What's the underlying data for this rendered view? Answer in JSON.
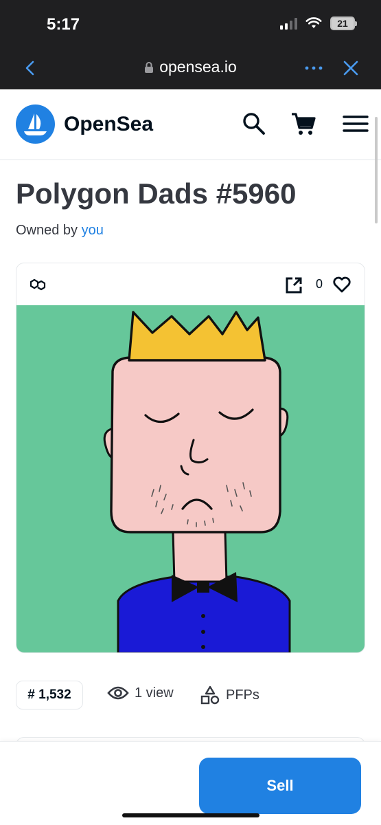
{
  "status_bar": {
    "time": "5:17",
    "battery": "21"
  },
  "browser": {
    "url": "opensea.io"
  },
  "header": {
    "logo_text": "OpenSea"
  },
  "nft": {
    "title": "Polygon Dads #5960",
    "owned_by_label": "Owned by",
    "owner": "you",
    "favorites_count": "0"
  },
  "stats": {
    "rank": "# 1,532",
    "views": "1 view",
    "collection": "PFPs"
  },
  "footer": {
    "sell_label": "Sell"
  },
  "colors": {
    "accent": "#2081e2",
    "image_bg": "#66c79a",
    "crown": "#f4c233",
    "face": "#f6c9c6",
    "shirt": "#1a1ad6"
  }
}
